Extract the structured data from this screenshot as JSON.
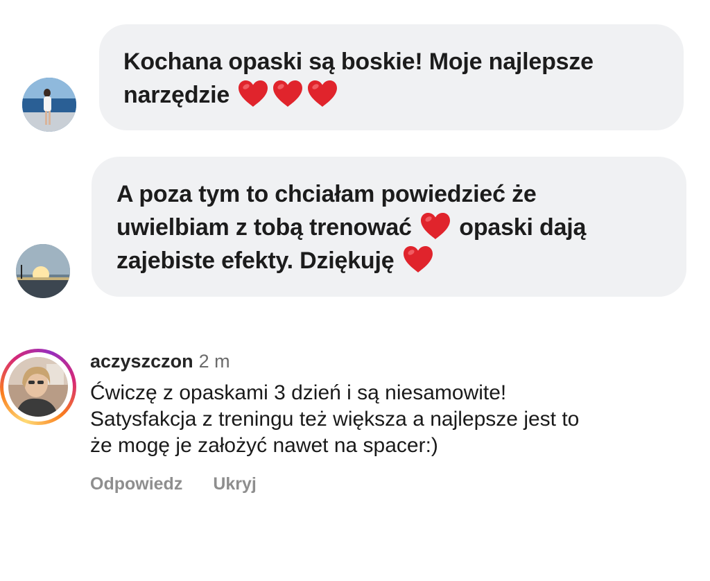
{
  "messages": [
    {
      "lines": [
        [
          "Kochana opaski są boskie! Moje najlepsze"
        ],
        [
          "narzędzie",
          "heart",
          "heart",
          "heart"
        ]
      ]
    },
    {
      "lines": [
        [
          "A poza tym to chciałam powiedzieć że"
        ],
        [
          "uwielbiam z tobą trenować",
          "heart",
          "opaski dają"
        ],
        [
          "zajebiste efekty. Dziękuję",
          "heart"
        ]
      ]
    }
  ],
  "comment": {
    "username": "aczyszczon",
    "time": "2 m",
    "lines": [
      "Ćwiczę z opaskami 3 dzień i są niesamowite!",
      "Satysfakcja z treningu też większa a najlepsze jest to",
      "że mogę je założyć nawet na spacer:)"
    ],
    "reply_label": "Odpowiedz",
    "hide_label": "Ukryj"
  },
  "colors": {
    "bubble_bg": "#f0f1f3",
    "heart": "#e0242c",
    "action_gray": "#8e8e8e"
  },
  "icons": {
    "heart": "red-heart-emoji"
  }
}
